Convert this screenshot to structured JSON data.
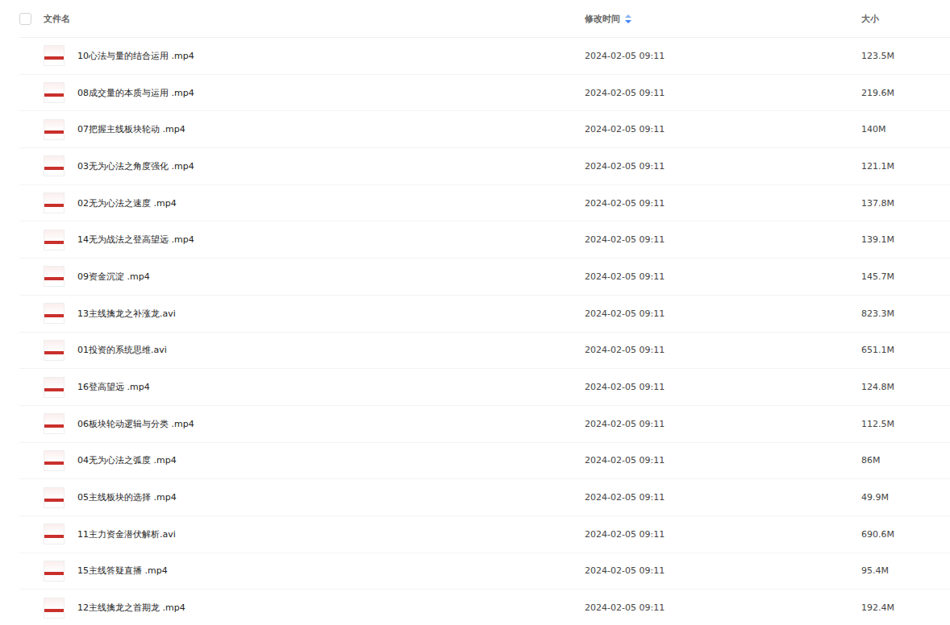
{
  "table": {
    "select_all": {
      "checked": false
    },
    "columns": [
      {
        "label": "文件名",
        "sorted": false
      },
      {
        "label": "修改时间",
        "sorted": true
      },
      {
        "label": "大小",
        "sorted": false
      }
    ],
    "rows": [
      {
        "name": "10心法与量的结合运用 .mp4",
        "modified": "2024-02-05 09:11",
        "size": "123.5M",
        "checked": false
      },
      {
        "name": "08成交量的本质与运用 .mp4",
        "modified": "2024-02-05 09:11",
        "size": "219.6M",
        "checked": false
      },
      {
        "name": "07把握主线板块轮动 .mp4",
        "modified": "2024-02-05 09:11",
        "size": "140M",
        "checked": false
      },
      {
        "name": "03无为心法之角度强化 .mp4",
        "modified": "2024-02-05 09:11",
        "size": "121.1M",
        "checked": false
      },
      {
        "name": "02无为心法之速度 .mp4",
        "modified": "2024-02-05 09:11",
        "size": "137.8M",
        "checked": false
      },
      {
        "name": "14无为战法之登高望远 .mp4",
        "modified": "2024-02-05 09:11",
        "size": "139.1M",
        "checked": false
      },
      {
        "name": "09资金沉淀 .mp4",
        "modified": "2024-02-05 09:11",
        "size": "145.7M",
        "checked": false
      },
      {
        "name": "13主线擒龙之补涨龙.avi",
        "modified": "2024-02-05 09:11",
        "size": "823.3M",
        "checked": false
      },
      {
        "name": "01投资的系统思维.avi",
        "modified": "2024-02-05 09:11",
        "size": "651.1M",
        "checked": false
      },
      {
        "name": "16登高望远 .mp4",
        "modified": "2024-02-05 09:11",
        "size": "124.8M",
        "checked": false
      },
      {
        "name": "06板块轮动逻辑与分类 .mp4",
        "modified": "2024-02-05 09:11",
        "size": "112.5M",
        "checked": false
      },
      {
        "name": "04无为心法之弧度 .mp4",
        "modified": "2024-02-05 09:11",
        "size": "86M",
        "checked": false
      },
      {
        "name": "05主线板块的选择 .mp4",
        "modified": "2024-02-05 09:11",
        "size": "49.9M",
        "checked": false
      },
      {
        "name": "11主力资金潜伏解析.avi",
        "modified": "2024-02-05 09:11",
        "size": "690.6M",
        "checked": false
      },
      {
        "name": "15主线答疑直播 .mp4",
        "modified": "2024-02-05 09:11",
        "size": "95.4M",
        "checked": false
      },
      {
        "name": "12主线擒龙之首期龙 .mp4",
        "modified": "2024-02-05 09:11",
        "size": "192.4M",
        "checked": false
      }
    ]
  }
}
